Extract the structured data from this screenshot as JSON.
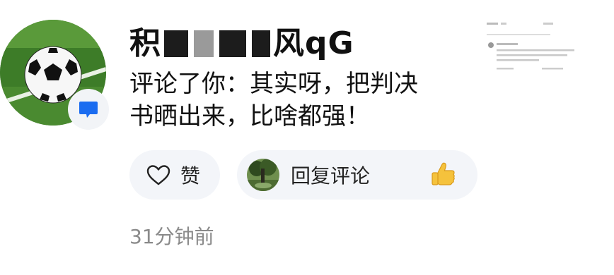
{
  "notification": {
    "username_prefix": "积",
    "username_suffix": "风qG",
    "comment_text": "评论了你：其实呀，把判决书晒出来，比啥都强！",
    "like_label": "赞",
    "reply_label": "回复评论",
    "timestamp": "31分钟前"
  },
  "colors": {
    "pill_bg": "#f3f5f9",
    "badge_icon": "#1a6cf0",
    "timestamp": "#8a8a8a"
  },
  "icons": {
    "avatar": "soccer-ball-avatar",
    "badge": "message-icon",
    "like": "heart-icon",
    "reply_avatar": "tree-avatar-icon",
    "thumbs": "thumbs-up-icon"
  }
}
